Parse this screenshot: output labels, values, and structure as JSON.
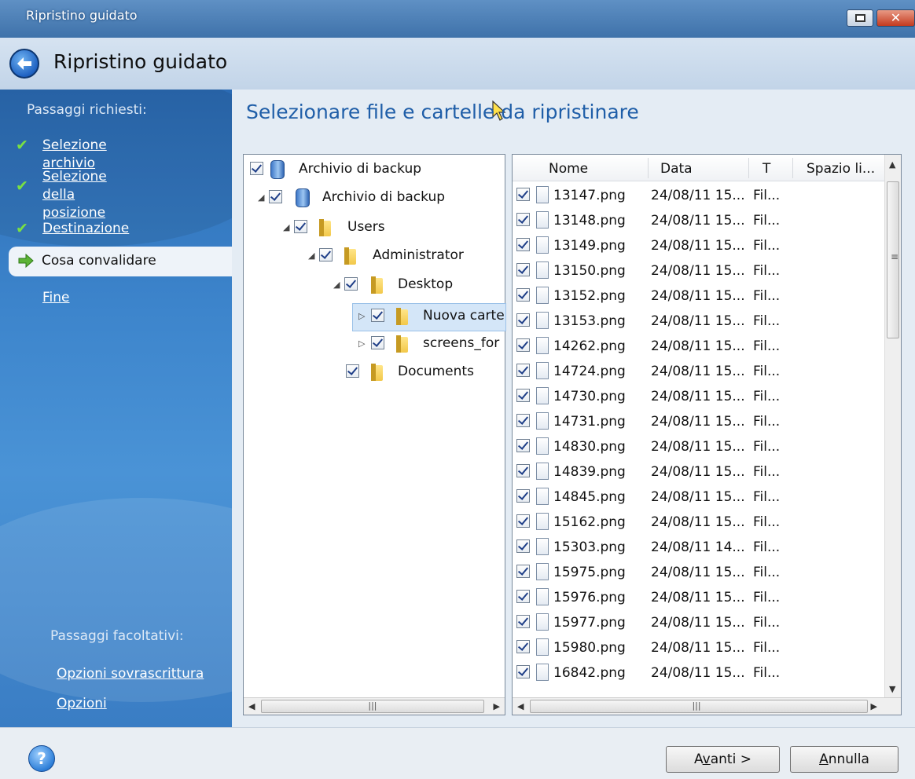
{
  "window": {
    "title": "Ripristino guidato"
  },
  "header": {
    "title": "Ripristino guidato"
  },
  "sidebar": {
    "required_title": "Passaggi richiesti:",
    "steps": [
      {
        "label": "Selezione archivio",
        "status": "done"
      },
      {
        "label": "Selezione della\nposizione",
        "status": "done"
      },
      {
        "label": "Destinazione",
        "status": "done"
      },
      {
        "label": "Cosa convalidare",
        "status": "current"
      },
      {
        "label": "Fine",
        "status": "pending"
      }
    ],
    "optional_title": "Passaggi facoltativi:",
    "optional_steps": [
      "Opzioni sovrascrittura",
      "Opzioni"
    ]
  },
  "main": {
    "title": "Selezionare file e cartelle da ripristinare"
  },
  "tree": {
    "items": [
      {
        "label": "Archivio di backup",
        "icon": "disk-icon",
        "checked": true
      },
      {
        "label": "Archivio di backup",
        "icon": "disk-icon",
        "checked": true,
        "expanded": true
      },
      {
        "label": "Users",
        "icon": "folder-icon",
        "checked": true,
        "expanded": true
      },
      {
        "label": "Administrator",
        "icon": "folder-icon",
        "checked": true,
        "expanded": true
      },
      {
        "label": "Desktop",
        "icon": "folder-icon",
        "checked": true,
        "expanded": true
      },
      {
        "label": "Nuova carte",
        "icon": "folder-icon",
        "checked": true,
        "selected": true
      },
      {
        "label": "screens_for",
        "icon": "folder-icon",
        "checked": true
      },
      {
        "label": "Documents",
        "icon": "folder-icon",
        "checked": true
      }
    ]
  },
  "filelist": {
    "columns": [
      "Nome",
      "Data",
      "T",
      "Spazio li..."
    ],
    "rows": [
      {
        "name": "13147.png",
        "date": "24/08/11 15...",
        "type": "Fil..."
      },
      {
        "name": "13148.png",
        "date": "24/08/11 15...",
        "type": "Fil..."
      },
      {
        "name": "13149.png",
        "date": "24/08/11 15...",
        "type": "Fil..."
      },
      {
        "name": "13150.png",
        "date": "24/08/11 15...",
        "type": "Fil..."
      },
      {
        "name": "13152.png",
        "date": "24/08/11 15...",
        "type": "Fil..."
      },
      {
        "name": "13153.png",
        "date": "24/08/11 15...",
        "type": "Fil..."
      },
      {
        "name": "14262.png",
        "date": "24/08/11 15...",
        "type": "Fil..."
      },
      {
        "name": "14724.png",
        "date": "24/08/11 15...",
        "type": "Fil..."
      },
      {
        "name": "14730.png",
        "date": "24/08/11 15...",
        "type": "Fil..."
      },
      {
        "name": "14731.png",
        "date": "24/08/11 15...",
        "type": "Fil..."
      },
      {
        "name": "14830.png",
        "date": "24/08/11 15...",
        "type": "Fil..."
      },
      {
        "name": "14839.png",
        "date": "24/08/11 15...",
        "type": "Fil..."
      },
      {
        "name": "14845.png",
        "date": "24/08/11 15...",
        "type": "Fil..."
      },
      {
        "name": "15162.png",
        "date": "24/08/11 15...",
        "type": "Fil..."
      },
      {
        "name": "15303.png",
        "date": "24/08/11 14...",
        "type": "Fil..."
      },
      {
        "name": "15975.png",
        "date": "24/08/11 15...",
        "type": "Fil..."
      },
      {
        "name": "15976.png",
        "date": "24/08/11 15...",
        "type": "Fil..."
      },
      {
        "name": "15977.png",
        "date": "24/08/11 15...",
        "type": "Fil..."
      },
      {
        "name": "15980.png",
        "date": "24/08/11 15...",
        "type": "Fil..."
      },
      {
        "name": "16842.png",
        "date": "24/08/11 15...",
        "type": "Fil..."
      }
    ]
  },
  "footer": {
    "next_label": "Avanti >",
    "next_accesskey": "v",
    "cancel_label": "Annulla",
    "cancel_accesskey": "A"
  },
  "colors": {
    "accent": "#1f5ea8",
    "sidebar": "#3d85cc",
    "check": "#79e043"
  }
}
